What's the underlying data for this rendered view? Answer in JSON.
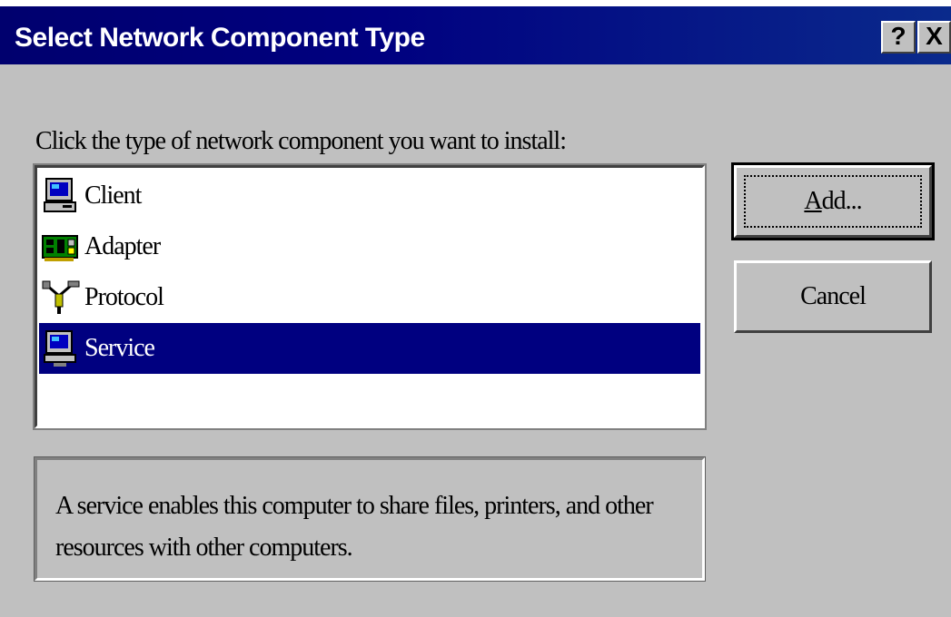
{
  "window": {
    "title": "Select Network Component Type",
    "help_label": "?",
    "close_label": "X"
  },
  "prompt": "Click the type of network component you want to install:",
  "list": {
    "items": [
      {
        "label": "Client",
        "icon": "client-computer-icon",
        "selected": false
      },
      {
        "label": "Adapter",
        "icon": "network-adapter-icon",
        "selected": false
      },
      {
        "label": "Protocol",
        "icon": "protocol-cable-icon",
        "selected": false
      },
      {
        "label": "Service",
        "icon": "service-computer-icon",
        "selected": true
      }
    ]
  },
  "buttons": {
    "add_label": "Add...",
    "cancel_label": "Cancel"
  },
  "description": "A service enables this computer to share files, printers, and other resources with other computers.",
  "colors": {
    "title_bar": "#000080",
    "face": "#c0c0c0",
    "selection": "#000080"
  }
}
